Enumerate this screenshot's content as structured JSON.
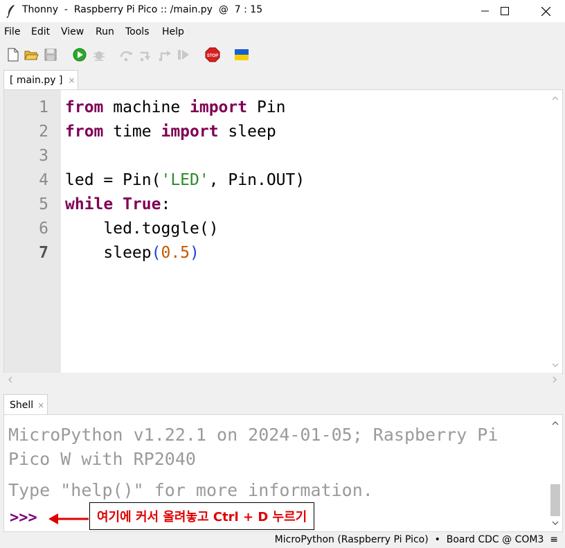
{
  "window": {
    "title": "Thonny  -  Raspberry Pi Pico :: /main.py  @  7 : 15"
  },
  "menu": [
    "File",
    "Edit",
    "View",
    "Run",
    "Tools",
    "Help"
  ],
  "toolbar": {
    "icons": [
      "new-file-icon",
      "open-folder-icon",
      "save-icon",
      "run-icon",
      "debug-icon",
      "step-over-icon",
      "step-into-icon",
      "step-out-icon",
      "resume-icon",
      "stop-icon",
      "ukraine-flag-icon"
    ],
    "stop_label": "STOP"
  },
  "editor": {
    "tab_label": "[ main.py ]",
    "tab_close": "×",
    "line_numbers": [
      "1",
      "2",
      "3",
      "4",
      "5",
      "6",
      "7"
    ],
    "current_line": "7",
    "code": {
      "l1": {
        "kw1": "from",
        "t1": " machine ",
        "kw2": "import",
        "t2": " Pin"
      },
      "l2": {
        "kw1": "from",
        "t1": " time ",
        "kw2": "import",
        "t2": " sleep"
      },
      "l4": {
        "t1": "led = Pin(",
        "str": "'LED'",
        "t2": ", Pin.OUT)"
      },
      "l5": {
        "kw1": "while",
        "t1": " ",
        "kw2": "True",
        "t2": ":"
      },
      "l6": {
        "t1": "    led.toggle()"
      },
      "l7": {
        "t1": "    sleep",
        "p1": "(",
        "num": "0.5",
        "p2": ")"
      }
    }
  },
  "shell": {
    "tab_label": "Shell",
    "tab_close": "×",
    "banner_line1": "MicroPython v1.22.1 on 2024-01-05; Raspberry Pi",
    "banner_line2": "Pico W with RP2040",
    "help_line": "Type \"help()\" for more information.",
    "prompt": ">>>",
    "annotation": "여기에 커서 올려놓고 Ctrl + D 누르기"
  },
  "status": {
    "text": "MicroPython (Raspberry Pi Pico)  •  Board CDC @ COM3  ≡"
  },
  "colors": {
    "keyword": "#7f0055",
    "string": "#2a8a2a",
    "number": "#c25a00",
    "paren": "#1f3fd8",
    "annotation_red": "#e00000",
    "prompt": "#7f0080"
  }
}
